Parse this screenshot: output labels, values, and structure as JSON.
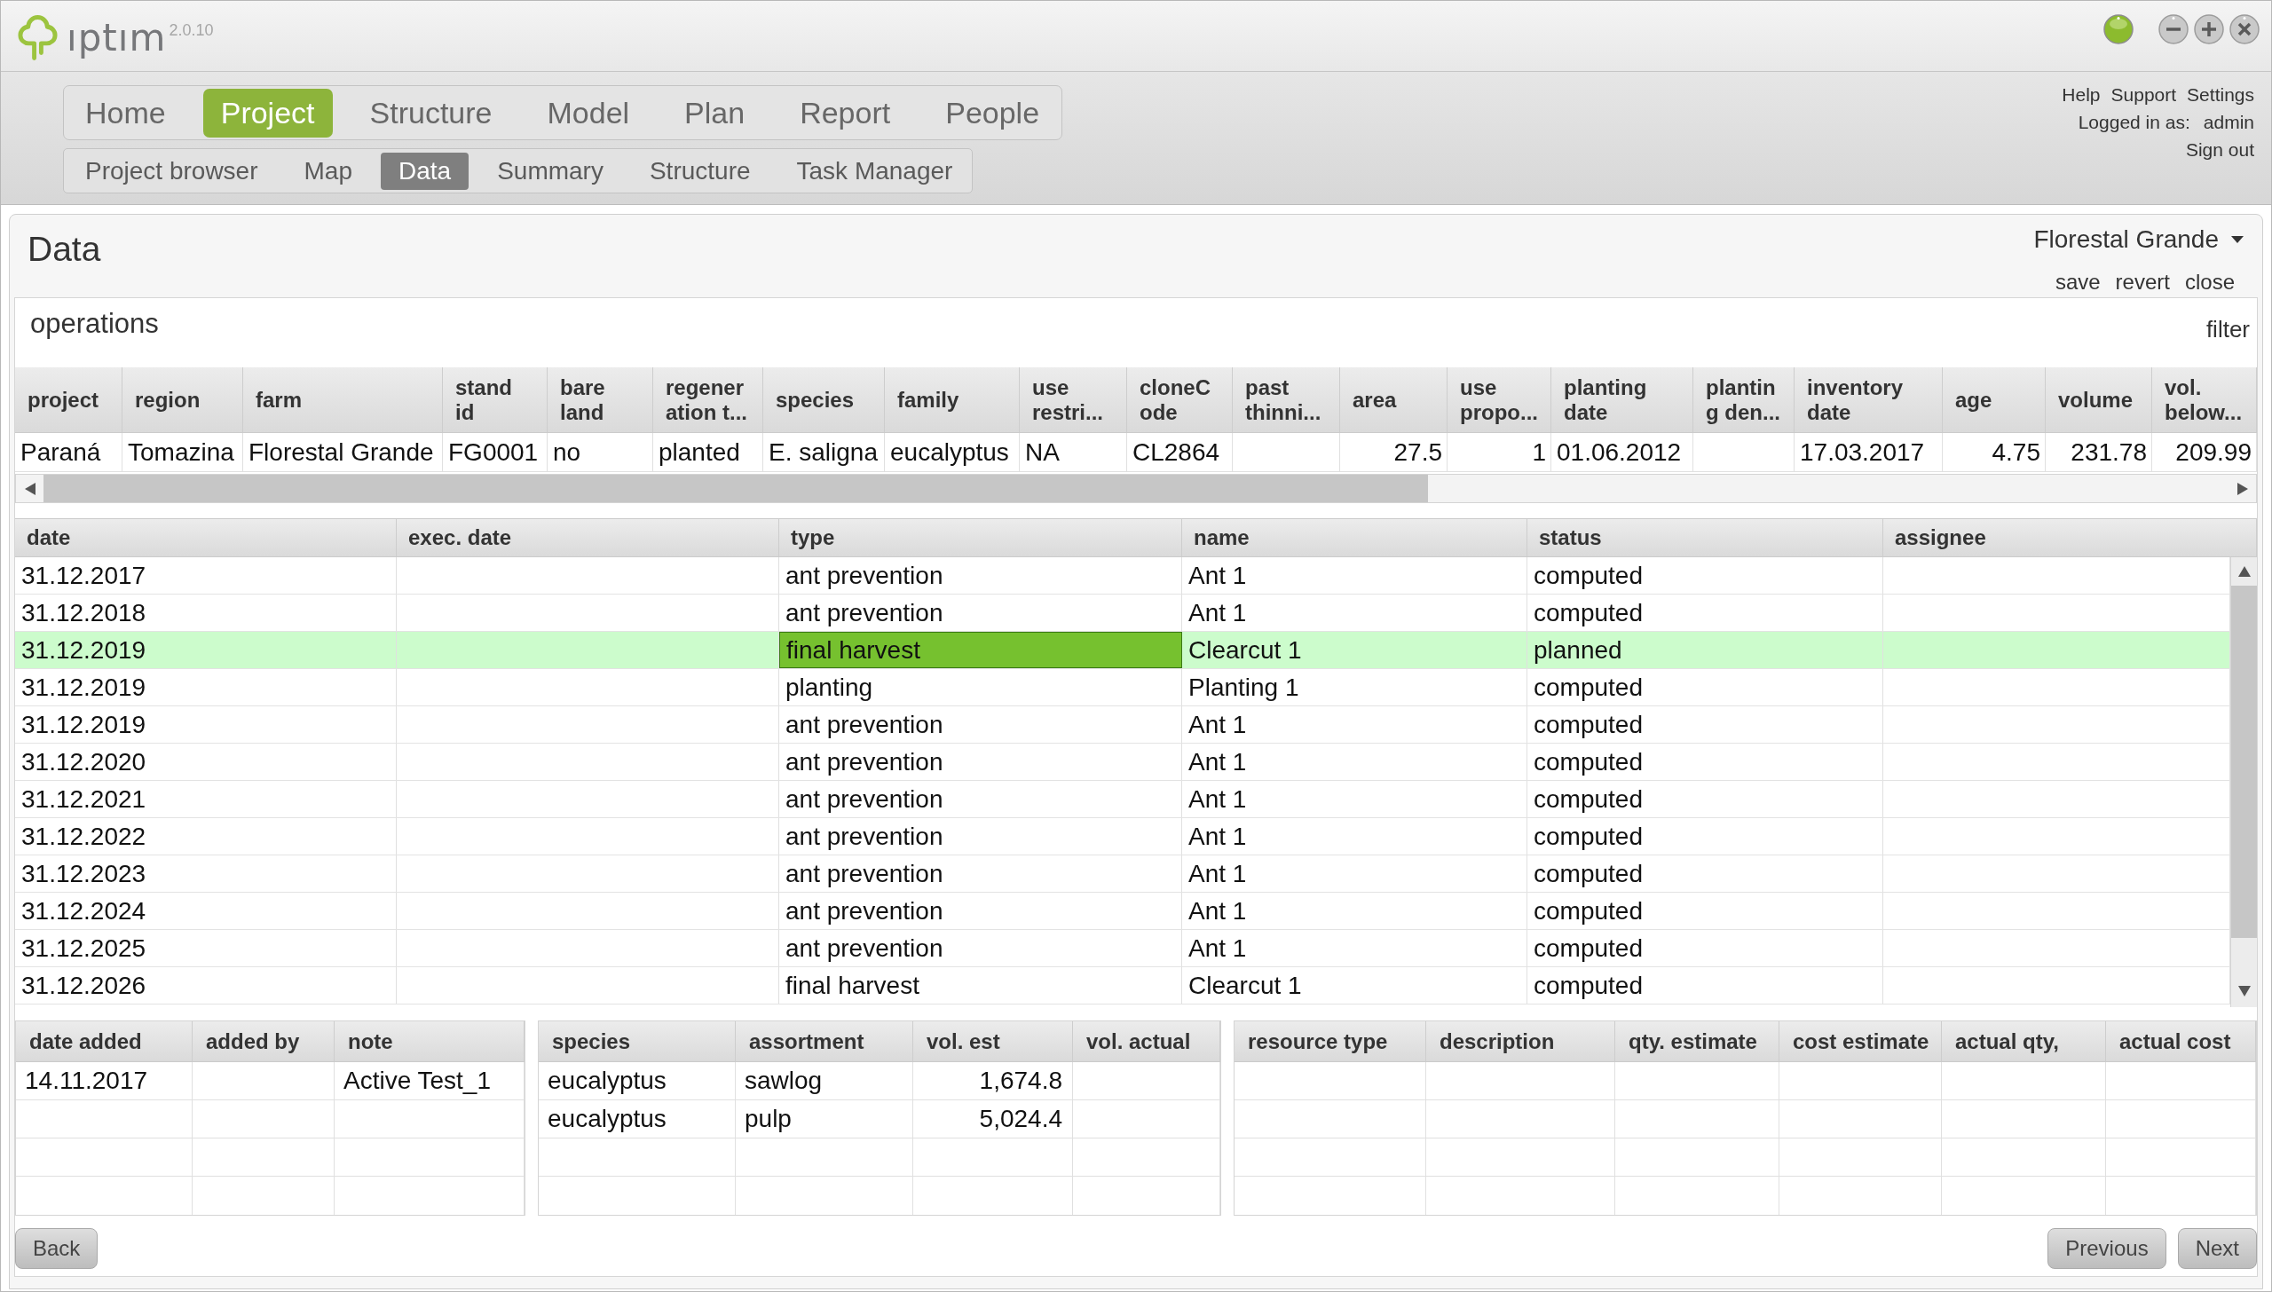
{
  "app": {
    "logo": "ıptım",
    "version": "2.0.10"
  },
  "main_nav": [
    {
      "label": "Home",
      "selected": false
    },
    {
      "label": "Project",
      "selected": true
    },
    {
      "label": "Structure",
      "selected": false
    },
    {
      "label": "Model",
      "selected": false
    },
    {
      "label": "Plan",
      "selected": false
    },
    {
      "label": "Report",
      "selected": false
    },
    {
      "label": "People",
      "selected": false
    }
  ],
  "sub_nav": [
    {
      "label": "Project browser",
      "selected": false
    },
    {
      "label": "Map",
      "selected": false
    },
    {
      "label": "Data",
      "selected": true
    },
    {
      "label": "Summary",
      "selected": false
    },
    {
      "label": "Structure",
      "selected": false
    },
    {
      "label": "Task Manager",
      "selected": false
    }
  ],
  "user_menu": {
    "links": [
      "Help",
      "Support",
      "Settings"
    ],
    "logged_in_label": "Logged in as:",
    "user": "admin",
    "sign_out": "Sign out"
  },
  "panel": {
    "title": "Data",
    "project_selector": "Florestal Grande",
    "actions": [
      "save",
      "revert",
      "close"
    ]
  },
  "operations": {
    "title": "operations",
    "filter": "filter"
  },
  "stand_table": {
    "columns": [
      {
        "label": "project",
        "right_aligned": false
      },
      {
        "label": "region",
        "right_aligned": false
      },
      {
        "label": "farm",
        "right_aligned": false
      },
      {
        "label": "stand id",
        "right_aligned": false
      },
      {
        "label": "bare land",
        "right_aligned": false
      },
      {
        "label": "regeneration t...",
        "right_aligned": false
      },
      {
        "label": "species",
        "right_aligned": false
      },
      {
        "label": "family",
        "right_aligned": false
      },
      {
        "label": "use restri...",
        "right_aligned": false
      },
      {
        "label": "cloneCode",
        "right_aligned": false
      },
      {
        "label": "past thinni..."
      },
      {
        "label": "area",
        "right_aligned": true
      },
      {
        "label": "use propo...",
        "right_aligned": true
      },
      {
        "label": "planting date",
        "right_aligned": false
      },
      {
        "label": "planting den..."
      },
      {
        "label": "inventory date",
        "right_aligned": false
      },
      {
        "label": "age",
        "right_aligned": true
      },
      {
        "label": "volume",
        "right_aligned": true
      },
      {
        "label": "vol. below...",
        "right_aligned": true
      }
    ],
    "rows": [
      [
        "Paraná",
        "Tomazina",
        "Florestal Grande",
        "FG0001",
        "no",
        "planted",
        "E. saligna",
        "eucalyptus",
        "NA",
        "CL2864",
        null,
        "27.5",
        "1",
        "01.06.2012",
        null,
        "17.03.2017",
        "4.75",
        "231.78",
        "209.99"
      ]
    ]
  },
  "operations_table": {
    "columns": [
      "date",
      "exec. date",
      "type",
      "name",
      "status",
      "assignee"
    ],
    "rows": [
      {
        "selected": false,
        "cells": [
          {
            "text": "31.12.2017",
            "focused": false
          },
          null,
          {
            "text": "ant prevention",
            "focused": false
          },
          {
            "text": "Ant 1",
            "focused": false
          },
          {
            "text": "computed",
            "focused": false
          },
          null
        ]
      },
      {
        "selected": false,
        "cells": [
          {
            "text": "31.12.2018",
            "focused": false
          },
          null,
          {
            "text": "ant prevention",
            "focused": false
          },
          {
            "text": "Ant 1",
            "focused": false
          },
          {
            "text": "computed",
            "focused": false
          },
          null
        ]
      },
      {
        "selected": true,
        "cells": [
          {
            "text": "31.12.2019",
            "focused": false
          },
          null,
          {
            "text": "final harvest",
            "focused": true
          },
          {
            "text": "Clearcut 1",
            "focused": false
          },
          {
            "text": "planned",
            "focused": false
          },
          null
        ]
      },
      {
        "selected": false,
        "cells": [
          {
            "text": "31.12.2019",
            "focused": false
          },
          null,
          {
            "text": "planting",
            "focused": false
          },
          {
            "text": "Planting 1",
            "focused": false
          },
          {
            "text": "computed",
            "focused": false
          },
          null
        ]
      },
      {
        "selected": false,
        "cells": [
          {
            "text": "31.12.2019",
            "focused": false
          },
          null,
          {
            "text": "ant prevention",
            "focused": false
          },
          {
            "text": "Ant 1",
            "focused": false
          },
          {
            "text": "computed",
            "focused": false
          },
          null
        ]
      },
      {
        "selected": false,
        "cells": [
          {
            "text": "31.12.2020",
            "focused": false
          },
          null,
          {
            "text": "ant prevention",
            "focused": false
          },
          {
            "text": "Ant 1",
            "focused": false
          },
          {
            "text": "computed",
            "focused": false
          },
          null
        ]
      },
      {
        "selected": false,
        "cells": [
          {
            "text": "31.12.2021",
            "focused": false
          },
          null,
          {
            "text": "ant prevention",
            "focused": false
          },
          {
            "text": "Ant 1",
            "focused": false
          },
          {
            "text": "computed",
            "focused": false
          },
          null
        ]
      },
      {
        "selected": false,
        "cells": [
          {
            "text": "31.12.2022",
            "focused": false
          },
          null,
          {
            "text": "ant prevention",
            "focused": false
          },
          {
            "text": "Ant 1",
            "focused": false
          },
          {
            "text": "computed",
            "focused": false
          },
          null
        ]
      },
      {
        "selected": false,
        "cells": [
          {
            "text": "31.12.2023",
            "focused": false
          },
          null,
          {
            "text": "ant prevention",
            "focused": false
          },
          {
            "text": "Ant 1",
            "focused": false
          },
          {
            "text": "computed",
            "focused": false
          },
          null
        ]
      },
      {
        "selected": false,
        "cells": [
          {
            "text": "31.12.2024",
            "focused": false
          },
          null,
          {
            "text": "ant prevention",
            "focused": false
          },
          {
            "text": "Ant 1",
            "focused": false
          },
          {
            "text": "computed",
            "focused": false
          },
          null
        ]
      },
      {
        "selected": false,
        "cells": [
          {
            "text": "31.12.2025",
            "focused": false
          },
          null,
          {
            "text": "ant prevention",
            "focused": false
          },
          {
            "text": "Ant 1",
            "focused": false
          },
          {
            "text": "computed",
            "focused": false
          },
          null
        ]
      },
      {
        "selected": false,
        "cells": [
          {
            "text": "31.12.2026",
            "focused": false
          },
          null,
          {
            "text": "final harvest",
            "focused": false
          },
          {
            "text": "Clearcut 1",
            "focused": false
          },
          {
            "text": "computed",
            "focused": false
          },
          null
        ]
      }
    ]
  },
  "notes_table": {
    "columns": [
      {
        "label": "date added",
        "right_aligned": false
      },
      {
        "label": "added by"
      },
      {
        "label": "note",
        "right_aligned": false
      }
    ],
    "rows": [
      [
        "14.11.2017",
        null,
        "Active Test_1"
      ],
      [
        null,
        null,
        null
      ],
      [
        null,
        null,
        null
      ],
      [
        null,
        null,
        null
      ]
    ]
  },
  "assortment_table": {
    "columns": [
      {
        "label": "species",
        "right_aligned": false
      },
      {
        "label": "assortment",
        "right_aligned": false
      },
      {
        "label": "vol. est",
        "right_aligned": true
      },
      {
        "label": "vol. actual"
      }
    ],
    "rows": [
      [
        "eucalyptus",
        "sawlog",
        "1,674.8",
        null
      ],
      [
        "eucalyptus",
        "pulp",
        "5,024.4",
        null
      ],
      [
        null,
        null,
        null,
        null
      ],
      [
        null,
        null,
        null,
        null
      ]
    ]
  },
  "resource_table": {
    "columns": [
      {
        "label": "resource type"
      },
      {
        "label": "description"
      },
      {
        "label": "qty. estimate"
      },
      {
        "label": "cost estimate"
      },
      {
        "label": "actual qty,"
      },
      {
        "label": "actual cost"
      }
    ],
    "rows": [
      [
        null,
        null,
        null,
        null,
        null,
        null
      ],
      [
        null,
        null,
        null,
        null,
        null,
        null
      ],
      [
        null,
        null,
        null,
        null,
        null,
        null
      ],
      [
        null,
        null,
        null,
        null,
        null,
        null
      ]
    ]
  },
  "footer": {
    "back": "Back",
    "previous": "Previous",
    "next": "Next"
  }
}
